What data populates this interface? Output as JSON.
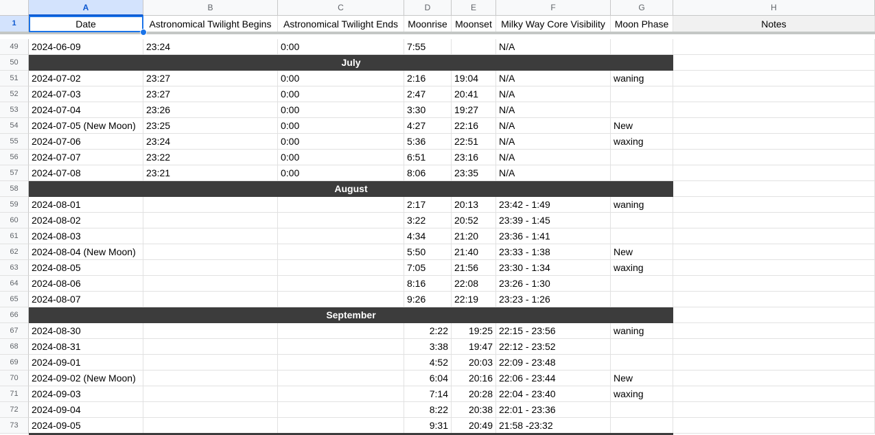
{
  "columns": [
    "A",
    "B",
    "C",
    "D",
    "E",
    "F",
    "G",
    "H"
  ],
  "selected_column": "A",
  "header_row": {
    "row_number": "1",
    "cells": [
      "Date",
      "Astronomical Twilight Begins",
      "Astronomical Twilight Ends",
      "Moonrise",
      "Moonset",
      "Milky Way Core Visibility",
      "Moon Phase",
      "Notes"
    ]
  },
  "rows": [
    {
      "n": "49",
      "type": "data",
      "cells": [
        "2024-06-09",
        "23:24",
        "0:00",
        "7:55",
        "",
        "N/A",
        "",
        ""
      ]
    },
    {
      "n": "50",
      "type": "month",
      "label": "July"
    },
    {
      "n": "51",
      "type": "data",
      "cells": [
        "2024-07-02",
        "23:27",
        "0:00",
        "2:16",
        "19:04",
        "N/A",
        "waning",
        ""
      ]
    },
    {
      "n": "52",
      "type": "data",
      "cells": [
        "2024-07-03",
        "23:27",
        "0:00",
        "2:47",
        "20:41",
        "N/A",
        "",
        ""
      ]
    },
    {
      "n": "53",
      "type": "data",
      "cells": [
        "2024-07-04",
        "23:26",
        "0:00",
        "3:30",
        "19:27",
        "N/A",
        "",
        ""
      ]
    },
    {
      "n": "54",
      "type": "data",
      "cells": [
        "2024-07-05 (New Moon)",
        "23:25",
        "0:00",
        "4:27",
        "22:16",
        "N/A",
        "New",
        ""
      ]
    },
    {
      "n": "55",
      "type": "data",
      "cells": [
        "2024-07-06",
        "23:24",
        "0:00",
        "5:36",
        "22:51",
        "N/A",
        "waxing",
        ""
      ]
    },
    {
      "n": "56",
      "type": "data",
      "cells": [
        "2024-07-07",
        "23:22",
        "0:00",
        "6:51",
        "23:16",
        "N/A",
        "",
        ""
      ]
    },
    {
      "n": "57",
      "type": "data",
      "cells": [
        "2024-07-08",
        "23:21",
        "0:00",
        "8:06",
        "23:35",
        "N/A",
        "",
        ""
      ]
    },
    {
      "n": "58",
      "type": "month",
      "label": "August"
    },
    {
      "n": "59",
      "type": "data",
      "cells": [
        "2024-08-01",
        "",
        "",
        "2:17",
        "20:13",
        "23:42 - 1:49",
        "waning",
        ""
      ]
    },
    {
      "n": "60",
      "type": "data",
      "cells": [
        "2024-08-02",
        "",
        "",
        "3:22",
        "20:52",
        "23:39 - 1:45",
        "",
        ""
      ]
    },
    {
      "n": "61",
      "type": "data",
      "cells": [
        "2024-08-03",
        "",
        "",
        "4:34",
        "21:20",
        "23:36 - 1:41",
        "",
        ""
      ]
    },
    {
      "n": "62",
      "type": "data",
      "cells": [
        "2024-08-04 (New Moon)",
        "",
        "",
        "5:50",
        "21:40",
        "23:33 - 1:38",
        "New",
        ""
      ]
    },
    {
      "n": "63",
      "type": "data",
      "cells": [
        "2024-08-05",
        "",
        "",
        "7:05",
        "21:56",
        "23:30 - 1:34",
        "waxing",
        ""
      ]
    },
    {
      "n": "64",
      "type": "data",
      "cells": [
        "2024-08-06",
        "",
        "",
        "8:16",
        "22:08",
        "23:26 - 1:30",
        "",
        ""
      ]
    },
    {
      "n": "65",
      "type": "data",
      "cells": [
        "2024-08-07",
        "",
        "",
        "9:26",
        "22:19",
        "23:23 - 1:26",
        "",
        ""
      ]
    },
    {
      "n": "66",
      "type": "month",
      "label": "September"
    },
    {
      "n": "67",
      "type": "data",
      "align": "right",
      "cells": [
        "2024-08-30",
        "",
        "",
        "2:22",
        "19:25",
        "22:15 - 23:56",
        "waning",
        ""
      ]
    },
    {
      "n": "68",
      "type": "data",
      "align": "right",
      "cells": [
        "2024-08-31",
        "",
        "",
        "3:38",
        "19:47",
        "22:12 - 23:52",
        "",
        ""
      ]
    },
    {
      "n": "69",
      "type": "data",
      "align": "right",
      "cells": [
        "2024-09-01",
        "",
        "",
        "4:52",
        "20:03",
        "22:09 - 23:48",
        "",
        ""
      ]
    },
    {
      "n": "70",
      "type": "data",
      "align": "right",
      "cells": [
        "2024-09-02 (New Moon)",
        "",
        "",
        "6:04",
        "20:16",
        "22:06 - 23:44",
        "New",
        ""
      ]
    },
    {
      "n": "71",
      "type": "data",
      "align": "right",
      "cells": [
        "2024-09-03",
        "",
        "",
        "7:14",
        "20:28",
        "22:04 - 23:40",
        "waxing",
        ""
      ]
    },
    {
      "n": "72",
      "type": "data",
      "align": "right",
      "cells": [
        "2024-09-04",
        "",
        "",
        "8:22",
        "20:38",
        "22:01 - 23:36",
        "",
        ""
      ]
    },
    {
      "n": "73",
      "type": "data",
      "align": "right",
      "cells": [
        "2024-09-05",
        "",
        "",
        "9:31",
        "20:49",
        "21:58 -23:32",
        "",
        ""
      ]
    }
  ],
  "colors": {
    "month_band": "#3c3c3c",
    "selection": "#1a73e8",
    "header_bg": "#f8f9fa"
  }
}
